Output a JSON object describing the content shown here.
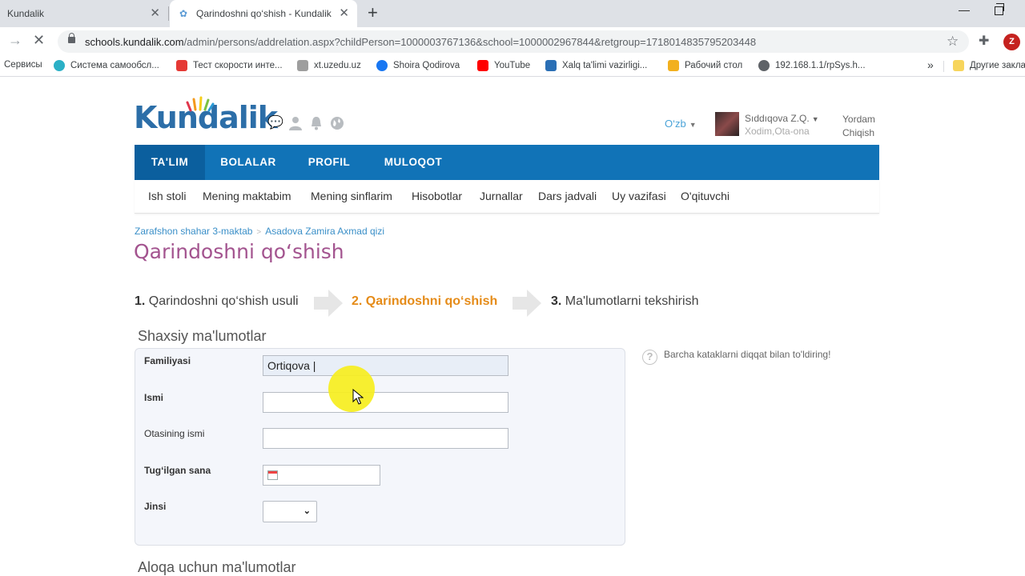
{
  "browser": {
    "tabs": [
      {
        "title": "Kundalik",
        "active": false
      },
      {
        "title": "Qarindoshni qo‘shish - Kundalik",
        "active": true
      }
    ],
    "url_host": "schools.kundalik.com",
    "url_path": "/admin/persons/addrelation.aspx?childPerson=1000003767136&school=1000002967844&retgroup=1718014835795203448",
    "profile_initial": "Z",
    "bookmarks": [
      {
        "label": "Сервисы",
        "icon": "apps-icon",
        "color": "#4285f4"
      },
      {
        "label": "Система самообсл...",
        "icon": "wave-icon",
        "color": "#2bb0c6"
      },
      {
        "label": "Тест скорости инте...",
        "icon": "speed-icon",
        "color": "#e53935"
      },
      {
        "label": "xt.uzedu.uz",
        "icon": "page-icon",
        "color": "#9e9e9e"
      },
      {
        "label": "Shoira Qodirova",
        "icon": "facebook-icon",
        "color": "#1877f2"
      },
      {
        "label": "YouTube",
        "icon": "youtube-icon",
        "color": "#ff0000"
      },
      {
        "label": "Xalq ta'limi vazirligi...",
        "icon": "edu-icon",
        "color": "#2a6fb5"
      },
      {
        "label": "Рабочий стол",
        "icon": "bulb-icon",
        "color": "#f2b01e"
      },
      {
        "label": "192.168.1.1/rpSys.h...",
        "icon": "globe-icon",
        "color": "#5f6368"
      },
      {
        "label": "Другие заклад",
        "icon": "folder-icon",
        "color": "#f7d55c"
      }
    ],
    "bookmarks_more": "»"
  },
  "header": {
    "logo_text": "Kundalik",
    "language": "O‘zb",
    "user_name": "Sıddıqova Z.Q.",
    "user_role": "Xodim,Ota-ona",
    "help_link": "Yordam",
    "logout_link": "Chiqish"
  },
  "main_nav": [
    {
      "label": "TA'LIM",
      "active": true
    },
    {
      "label": "BOLALAR",
      "active": false
    },
    {
      "label": "PROFIL",
      "active": false
    },
    {
      "label": "MULOQOT",
      "active": false
    }
  ],
  "sub_nav": [
    "Ish stoli",
    "Mening maktabim",
    "Mening sinflarim",
    "Hisobotlar",
    "Jurnallar",
    "Dars jadvali",
    "Uy vazifasi",
    "O'qituvchi"
  ],
  "breadcrumb": [
    "Zarafshon shahar 3-maktab",
    "Asadova Zamira Axmad qizi"
  ],
  "breadcrumb_sep": ">",
  "page_title": "Qarindoshni qo‘shish",
  "steps": [
    {
      "num": "1.",
      "label": "Qarindoshni qo‘shish usuli",
      "current": false
    },
    {
      "num": "2.",
      "label": "Qarindoshni qo‘shish",
      "current": true
    },
    {
      "num": "3.",
      "label": "Ma'lumotlarni tekshirish",
      "current": false
    }
  ],
  "personal_section": {
    "title": "Shaxsiy ma'lumotlar",
    "fields": {
      "surname_label": "Familiyasi",
      "surname_value": "Ortiqova |",
      "name_label": "Ismi",
      "name_value": "",
      "patronymic_label": "Otasining ismi",
      "patronymic_value": "",
      "birthdate_label": "Tug‘ilgan sana",
      "birthdate_value": "",
      "gender_label": "Jinsi",
      "gender_value": ""
    }
  },
  "hint_text": "Barcha kataklarni diqqat bilan to'ldiring!",
  "contact_section": {
    "title": "Aloqa uchun ma'lumotlar"
  },
  "colors": {
    "nav_blue": "#1173b7",
    "nav_active": "#0b5f9e",
    "title_purple": "#a3548f",
    "step_current": "#e58b18",
    "link_blue": "#3a8fc8",
    "cursor_highlight": "#f6ee1e"
  }
}
